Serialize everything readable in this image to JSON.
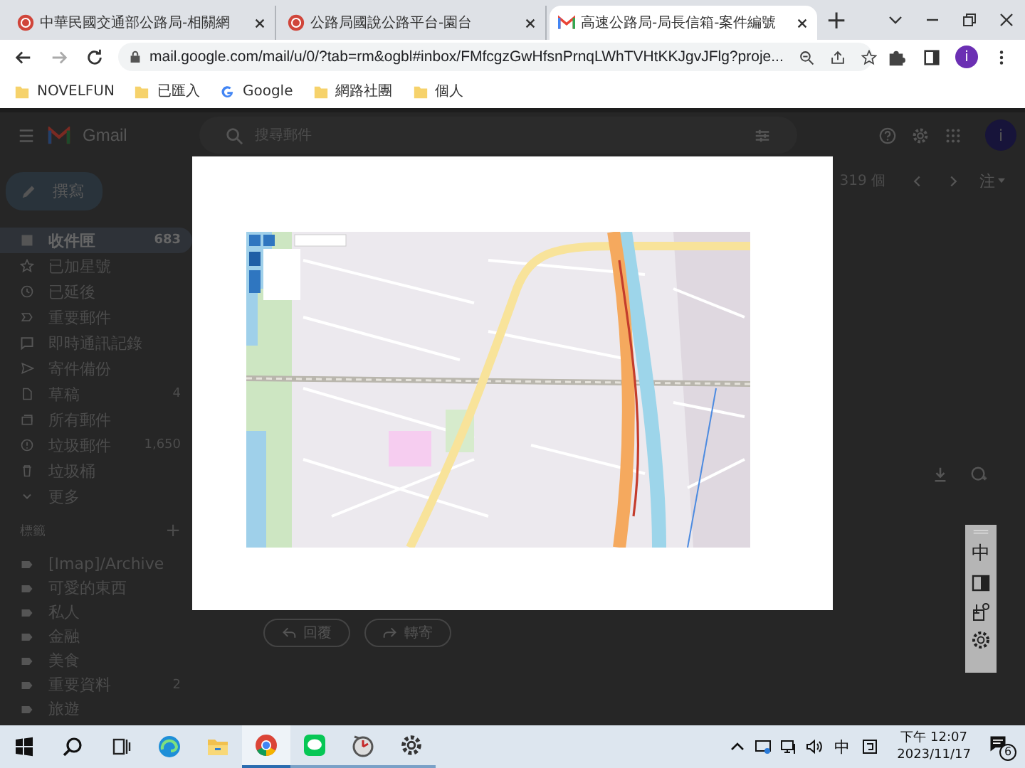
{
  "browser": {
    "tabs": [
      {
        "kind": "emblem",
        "title": "中華民國交通部公路局-相關網",
        "selected": false
      },
      {
        "kind": "emblem",
        "title": "公路局國說公路平台-園台",
        "selected": false
      },
      {
        "kind": "gmail",
        "title": "高速公路局-局長信箱-案件編號",
        "selected": true
      }
    ],
    "new_tab": "+",
    "address": "mail.google.com/mail/u/0/?tab=rm&ogbl#inbox/FMfcgzGwHfsnPrnqLWhTVHtKKJgvJFlg?proje...",
    "profile": "i",
    "bookmarks": [
      {
        "kind": "folder",
        "label": "NOVELFUN"
      },
      {
        "kind": "folder",
        "label": "已匯入"
      },
      {
        "kind": "google",
        "label": "Google"
      },
      {
        "kind": "folder",
        "label": "網路社團"
      },
      {
        "kind": "folder",
        "label": "個人"
      }
    ]
  },
  "gmail": {
    "brand": "Gmail",
    "search": {
      "placeholder": "搜尋郵件"
    },
    "avatar": "i",
    "compose": "撰寫",
    "mailbox": [
      {
        "kind": "inbox",
        "label": "收件匣",
        "count": "683",
        "selected": true
      },
      {
        "kind": "star",
        "label": "已加星號",
        "selected": false
      },
      {
        "kind": "clock",
        "label": "已延後",
        "selected": false
      },
      {
        "kind": "important",
        "label": "重要郵件",
        "selected": false
      },
      {
        "kind": "chat",
        "label": "即時通訊記錄",
        "selected": false
      },
      {
        "kind": "send",
        "label": "寄件備份",
        "selected": false
      },
      {
        "kind": "draft",
        "label": "草稿",
        "count": "4",
        "selected": false
      },
      {
        "kind": "all",
        "label": "所有郵件",
        "selected": false
      },
      {
        "kind": "spam",
        "label": "垃圾郵件",
        "count": "1,650",
        "selected": false
      },
      {
        "kind": "trash",
        "label": "垃圾桶",
        "selected": false
      },
      {
        "kind": "more",
        "label": "更多",
        "selected": false
      }
    ],
    "labels_heading": "標籤",
    "labels_add": "+",
    "labels": [
      {
        "label": "[Imap]/Archive"
      },
      {
        "label": "可愛的東西"
      },
      {
        "label": "私人"
      },
      {
        "label": "金融"
      },
      {
        "label": "美食"
      },
      {
        "label": "重要資料",
        "count": "2"
      },
      {
        "label": "旅遊"
      }
    ],
    "message_count": "319 個",
    "input_mode": "注",
    "actions": [
      {
        "kind": "reply",
        "label": "回覆"
      },
      {
        "kind": "forward",
        "label": "轉寄"
      }
    ]
  },
  "ime_toolbar": {
    "mode": "中"
  },
  "taskbar": {
    "apps": [
      {
        "kind": "edge",
        "running": false,
        "selected": false
      },
      {
        "kind": "files",
        "running": false,
        "selected": false
      },
      {
        "kind": "chrome",
        "running": true,
        "selected": true
      },
      {
        "kind": "line",
        "running": true,
        "selected": false
      },
      {
        "kind": "clock",
        "running": true,
        "selected": false
      },
      {
        "kind": "settings",
        "running": true,
        "selected": false
      }
    ],
    "ime": "中",
    "time": "下午 12:07",
    "date": "2023/11/17",
    "notifications": "6"
  }
}
